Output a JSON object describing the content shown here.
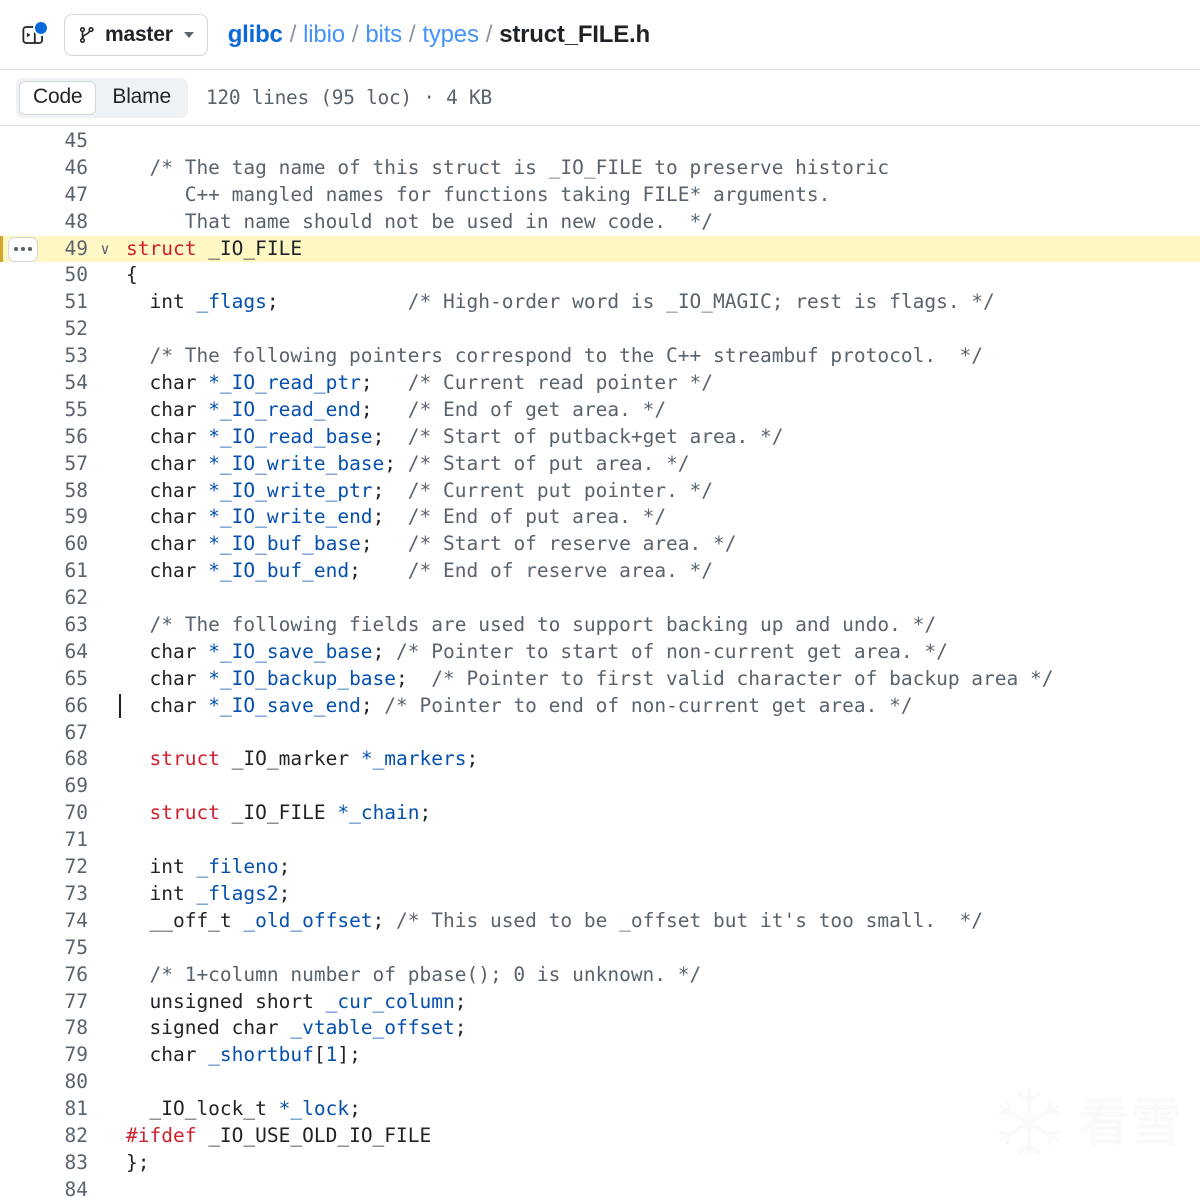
{
  "header": {
    "sidebar_toggle_icon": "sidebar-expand-icon",
    "notification_dot": true,
    "branch": {
      "icon": "git-branch-icon",
      "name": "master",
      "caret_icon": "chevron-down-icon"
    },
    "breadcrumb": {
      "root": "glibc",
      "parts": [
        "libio",
        "bits",
        "types"
      ],
      "file": "struct_FILE.h",
      "separator": "/"
    }
  },
  "toolbar": {
    "tabs": [
      {
        "label": "Code",
        "active": true
      },
      {
        "label": "Blame",
        "active": false
      }
    ],
    "file_meta": "120 lines (95 loc) · 4 KB"
  },
  "code": {
    "highlight_line": 49,
    "caret_line": 62,
    "kebab_icon": "kebab-horizontal-icon",
    "fold_icon": "chevron-down-icon",
    "lines": [
      {
        "n": 45,
        "tokens": []
      },
      {
        "n": 46,
        "tokens": [
          {
            "t": "cm",
            "s": "  /* The tag name of this struct is _IO_FILE to preserve historic"
          }
        ]
      },
      {
        "n": 47,
        "tokens": [
          {
            "t": "cm",
            "s": "     C++ mangled names for functions taking FILE* arguments."
          }
        ]
      },
      {
        "n": 48,
        "tokens": [
          {
            "t": "cm",
            "s": "     That name should not be used in new code.  */"
          }
        ]
      },
      {
        "n": 49,
        "fold": true,
        "tokens": [
          {
            "t": "pl",
            "s": ""
          },
          {
            "t": "kw",
            "s": "struct"
          },
          {
            "t": "pl",
            "s": " _IO_FILE"
          }
        ]
      },
      {
        "n": 50,
        "tokens": [
          {
            "t": "pl",
            "s": "{"
          }
        ]
      },
      {
        "n": 51,
        "tokens": [
          {
            "t": "pl",
            "s": "  int "
          },
          {
            "t": "var",
            "s": "_flags"
          },
          {
            "t": "pl",
            "s": ";"
          },
          {
            "t": "cm",
            "s": "           /* High-order word is _IO_MAGIC; rest is flags. */"
          }
        ]
      },
      {
        "n": 52,
        "tokens": []
      },
      {
        "n": 53,
        "tokens": [
          {
            "t": "cm",
            "s": "  /* The following pointers correspond to the C++ streambuf protocol.  */"
          }
        ]
      },
      {
        "n": 54,
        "tokens": [
          {
            "t": "pl",
            "s": "  char "
          },
          {
            "t": "var",
            "s": "*_IO_read_ptr"
          },
          {
            "t": "pl",
            "s": ";"
          },
          {
            "t": "cm",
            "s": "   /* Current read pointer */"
          }
        ]
      },
      {
        "n": 55,
        "tokens": [
          {
            "t": "pl",
            "s": "  char "
          },
          {
            "t": "var",
            "s": "*_IO_read_end"
          },
          {
            "t": "pl",
            "s": ";"
          },
          {
            "t": "cm",
            "s": "   /* End of get area. */"
          }
        ]
      },
      {
        "n": 56,
        "tokens": [
          {
            "t": "pl",
            "s": "  char "
          },
          {
            "t": "var",
            "s": "*_IO_read_base"
          },
          {
            "t": "pl",
            "s": ";"
          },
          {
            "t": "cm",
            "s": "  /* Start of putback+get area. */"
          }
        ]
      },
      {
        "n": 57,
        "tokens": [
          {
            "t": "pl",
            "s": "  char "
          },
          {
            "t": "var",
            "s": "*_IO_write_base"
          },
          {
            "t": "pl",
            "s": ";"
          },
          {
            "t": "cm",
            "s": " /* Start of put area. */"
          }
        ]
      },
      {
        "n": 58,
        "tokens": [
          {
            "t": "pl",
            "s": "  char "
          },
          {
            "t": "var",
            "s": "*_IO_write_ptr"
          },
          {
            "t": "pl",
            "s": ";"
          },
          {
            "t": "cm",
            "s": "  /* Current put pointer. */"
          }
        ]
      },
      {
        "n": 59,
        "tokens": [
          {
            "t": "pl",
            "s": "  char "
          },
          {
            "t": "var",
            "s": "*_IO_write_end"
          },
          {
            "t": "pl",
            "s": ";"
          },
          {
            "t": "cm",
            "s": "  /* End of put area. */"
          }
        ]
      },
      {
        "n": 60,
        "tokens": [
          {
            "t": "pl",
            "s": "  char "
          },
          {
            "t": "var",
            "s": "*_IO_buf_base"
          },
          {
            "t": "pl",
            "s": ";"
          },
          {
            "t": "cm",
            "s": "   /* Start of reserve area. */"
          }
        ]
      },
      {
        "n": 61,
        "tokens": [
          {
            "t": "pl",
            "s": "  char "
          },
          {
            "t": "var",
            "s": "*_IO_buf_end"
          },
          {
            "t": "pl",
            "s": ";"
          },
          {
            "t": "cm",
            "s": "    /* End of reserve area. */"
          }
        ]
      },
      {
        "n": 62,
        "tokens": []
      },
      {
        "n": 63,
        "tokens": [
          {
            "t": "cm",
            "s": "  /* The following fields are used to support backing up and undo. */"
          }
        ]
      },
      {
        "n": 64,
        "tokens": [
          {
            "t": "pl",
            "s": "  char "
          },
          {
            "t": "var",
            "s": "*_IO_save_base"
          },
          {
            "t": "pl",
            "s": ";"
          },
          {
            "t": "cm",
            "s": " /* Pointer to start of non-current get area. */"
          }
        ]
      },
      {
        "n": 65,
        "tokens": [
          {
            "t": "pl",
            "s": "  char "
          },
          {
            "t": "var",
            "s": "*_IO_backup_base"
          },
          {
            "t": "pl",
            "s": ";"
          },
          {
            "t": "cm",
            "s": "  /* Pointer to first valid character of backup area */"
          }
        ]
      },
      {
        "n": 66,
        "tokens": [
          {
            "t": "pl",
            "s": "  char "
          },
          {
            "t": "var",
            "s": "*_IO_save_end"
          },
          {
            "t": "pl",
            "s": ";"
          },
          {
            "t": "cm",
            "s": " /* Pointer to end of non-current get area. */"
          }
        ]
      },
      {
        "n": 67,
        "tokens": []
      },
      {
        "n": 68,
        "tokens": [
          {
            "t": "pl",
            "s": "  "
          },
          {
            "t": "kw",
            "s": "struct"
          },
          {
            "t": "pl",
            "s": " _IO_marker "
          },
          {
            "t": "var",
            "s": "*_markers"
          },
          {
            "t": "pl",
            "s": ";"
          }
        ]
      },
      {
        "n": 69,
        "tokens": []
      },
      {
        "n": 70,
        "tokens": [
          {
            "t": "pl",
            "s": "  "
          },
          {
            "t": "kw",
            "s": "struct"
          },
          {
            "t": "pl",
            "s": " _IO_FILE "
          },
          {
            "t": "var",
            "s": "*_chain"
          },
          {
            "t": "pl",
            "s": ";"
          }
        ]
      },
      {
        "n": 71,
        "tokens": []
      },
      {
        "n": 72,
        "tokens": [
          {
            "t": "pl",
            "s": "  int "
          },
          {
            "t": "var",
            "s": "_fileno"
          },
          {
            "t": "pl",
            "s": ";"
          }
        ]
      },
      {
        "n": 73,
        "tokens": [
          {
            "t": "pl",
            "s": "  int "
          },
          {
            "t": "var",
            "s": "_flags2"
          },
          {
            "t": "pl",
            "s": ";"
          }
        ]
      },
      {
        "n": 74,
        "tokens": [
          {
            "t": "pl",
            "s": "  __off_t "
          },
          {
            "t": "var",
            "s": "_old_offset"
          },
          {
            "t": "pl",
            "s": ";"
          },
          {
            "t": "cm",
            "s": " /* This used to be _offset but it's too small.  */"
          }
        ]
      },
      {
        "n": 75,
        "tokens": []
      },
      {
        "n": 76,
        "tokens": [
          {
            "t": "cm",
            "s": "  /* 1+column number of pbase(); 0 is unknown. */"
          }
        ]
      },
      {
        "n": 77,
        "tokens": [
          {
            "t": "pl",
            "s": "  unsigned short "
          },
          {
            "t": "var",
            "s": "_cur_column"
          },
          {
            "t": "pl",
            "s": ";"
          }
        ]
      },
      {
        "n": 78,
        "tokens": [
          {
            "t": "pl",
            "s": "  signed char "
          },
          {
            "t": "var",
            "s": "_vtable_offset"
          },
          {
            "t": "pl",
            "s": ";"
          }
        ]
      },
      {
        "n": 79,
        "tokens": [
          {
            "t": "pl",
            "s": "  char "
          },
          {
            "t": "var",
            "s": "_shortbuf"
          },
          {
            "t": "pl",
            "s": "["
          },
          {
            "t": "num",
            "s": "1"
          },
          {
            "t": "pl",
            "s": "];"
          }
        ]
      },
      {
        "n": 80,
        "tokens": []
      },
      {
        "n": 81,
        "tokens": [
          {
            "t": "pl",
            "s": "  _IO_lock_t "
          },
          {
            "t": "var",
            "s": "*_lock"
          },
          {
            "t": "pl",
            "s": ";"
          }
        ]
      },
      {
        "n": 82,
        "tokens": [
          {
            "t": "kw",
            "s": "#ifdef"
          },
          {
            "t": "pl",
            "s": " _IO_USE_OLD_IO_FILE"
          }
        ]
      },
      {
        "n": 83,
        "tokens": [
          {
            "t": "pl",
            "s": "};"
          }
        ]
      },
      {
        "n": 84,
        "tokens": []
      }
    ]
  },
  "watermark": {
    "icon": "snowflake-icon",
    "text": "看雪"
  },
  "colors": {
    "accent": "#0969da",
    "keyword": "#cf222e",
    "variable": "#0550ae",
    "comment": "#59636e",
    "highlight_bg": "#fff8c5",
    "highlight_edge": "#d4a72c"
  }
}
